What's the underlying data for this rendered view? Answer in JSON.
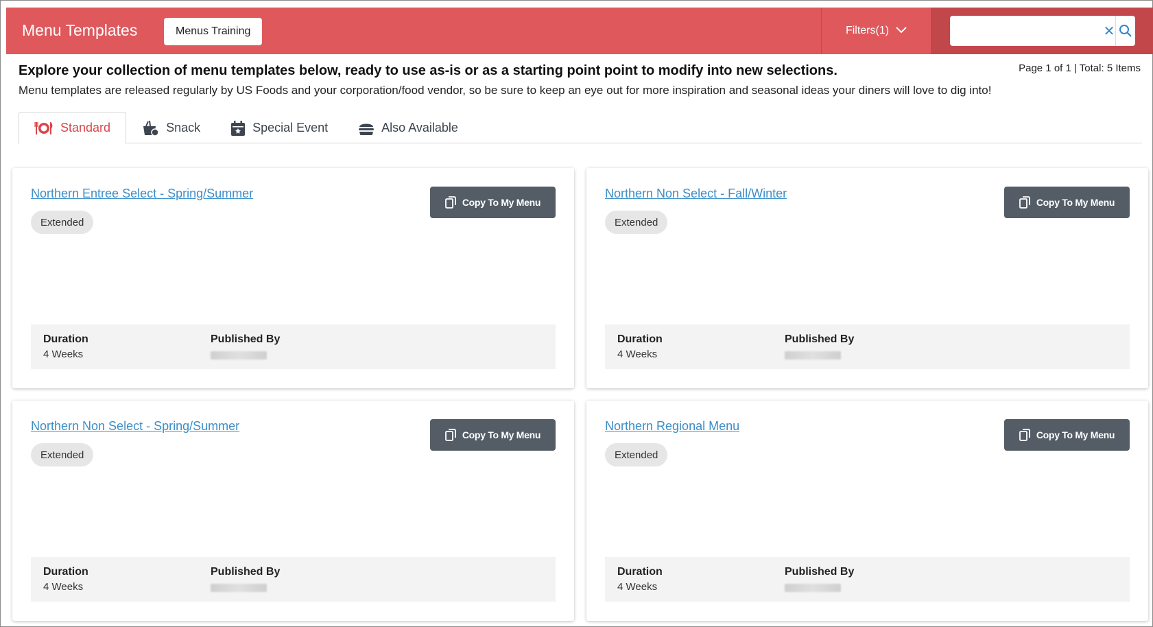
{
  "header": {
    "title": "Menu Templates",
    "training_button": "Menus Training",
    "filters_label": "Filters(1)",
    "search": {
      "value": "",
      "placeholder": ""
    }
  },
  "intro": {
    "title": "Explore your collection of menu templates below, ready to use as-is or as a starting point point to modify into new selections.",
    "description": "Menu templates are released regularly by US Foods and your corporation/food vendor, so be sure to keep an eye out for more inspiration and seasonal ideas your diners will love to dig into!",
    "pagination": "Page 1 of 1 | Total: 5 Items"
  },
  "tabs": [
    {
      "label": "Standard",
      "icon": "utensils-plate-icon",
      "active": true
    },
    {
      "label": "Snack",
      "icon": "snack-basket-icon",
      "active": false
    },
    {
      "label": "Special Event",
      "icon": "calendar-event-icon",
      "active": false
    },
    {
      "label": "Also Available",
      "icon": "burger-icon",
      "active": false
    }
  ],
  "cards": [
    {
      "title": "Northern Entree Select - Spring/Summer",
      "badge": "Extended",
      "copy_label": "Copy To My Menu",
      "duration_label": "Duration",
      "duration_value": "4 Weeks",
      "published_label": "Published By"
    },
    {
      "title": "Northern Non Select - Fall/Winter",
      "badge": "Extended",
      "copy_label": "Copy To My Menu",
      "duration_label": "Duration",
      "duration_value": "4 Weeks",
      "published_label": "Published By"
    },
    {
      "title": "Northern Non Select - Spring/Summer",
      "badge": "Extended",
      "copy_label": "Copy To My Menu",
      "duration_label": "Duration",
      "duration_value": "4 Weeks",
      "published_label": "Published By"
    },
    {
      "title": "Northern Regional Menu",
      "badge": "Extended",
      "copy_label": "Copy To My Menu",
      "duration_label": "Duration",
      "duration_value": "4 Weeks",
      "published_label": "Published By"
    }
  ],
  "colors": {
    "header_bg": "#df585c",
    "search_bg": "#c2474b",
    "accent_active_tab": "#d9464b",
    "link": "#3b8ec8",
    "copy_button": "#545d66"
  }
}
